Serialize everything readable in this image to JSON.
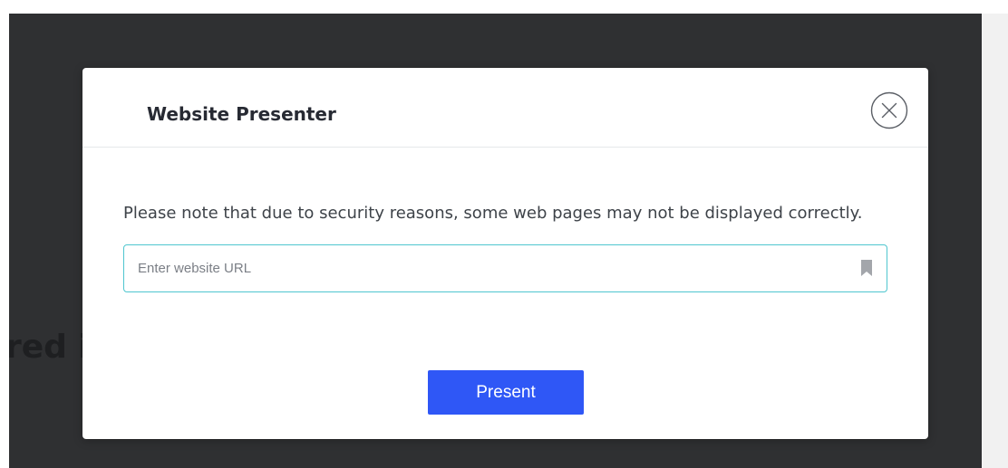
{
  "background": {
    "partial_heading": "red i"
  },
  "modal": {
    "title": "Website Presenter",
    "close_icon": "close-circle-icon",
    "notice": "Please note that due to security reasons, some web pages may not be displayed correctly.",
    "url_input": {
      "value": "",
      "placeholder": "Enter website URL",
      "icon": "bookmark-icon"
    },
    "present_label": "Present"
  },
  "colors": {
    "backdrop": "#2f3032",
    "accent_button": "#2f57f6",
    "input_border": "#4fc6cf"
  }
}
